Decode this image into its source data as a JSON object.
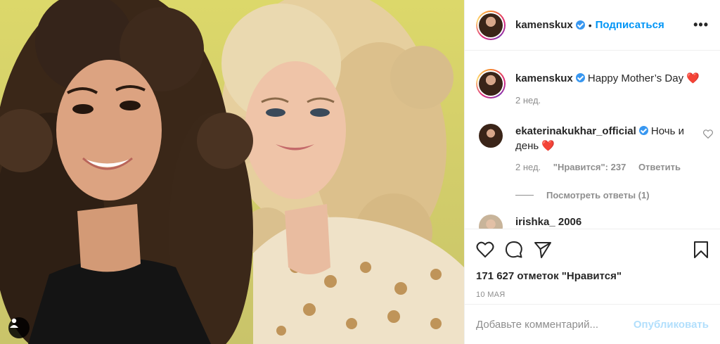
{
  "post": {
    "author": "kamenskux",
    "follow_label": "Подписаться",
    "separator": "•",
    "more_label": "•••",
    "caption": {
      "username": "kamenskux",
      "text": "Happy Mother’s Day",
      "emoji": "❤️",
      "time": "2 нед."
    },
    "comments": [
      {
        "username": "ekaterinakukhar_official",
        "text": "Ночь и день",
        "emoji": "❤️",
        "time": "2 нед.",
        "likes": "\"Нравится\": 237",
        "reply_label": "Ответить",
        "view_replies": "Посмотреть ответы (1)"
      },
      {
        "username": "irishka_ 2006"
      }
    ],
    "likes": "171 627 отметок \"Нравится\"",
    "date": "10 МАЯ",
    "comment_placeholder": "Добавьте комментарий...",
    "publish_label": "Опубликовать"
  },
  "colors": {
    "link_blue": "#0095f6",
    "verified": "#3897f0",
    "heart_red": "#ed4956",
    "publish_disabled": "#b2dffc"
  },
  "icons": [
    "user-tag-icon",
    "verified-icon",
    "more-icon",
    "heart-icon",
    "comment-icon",
    "share-icon",
    "bookmark-icon"
  ]
}
